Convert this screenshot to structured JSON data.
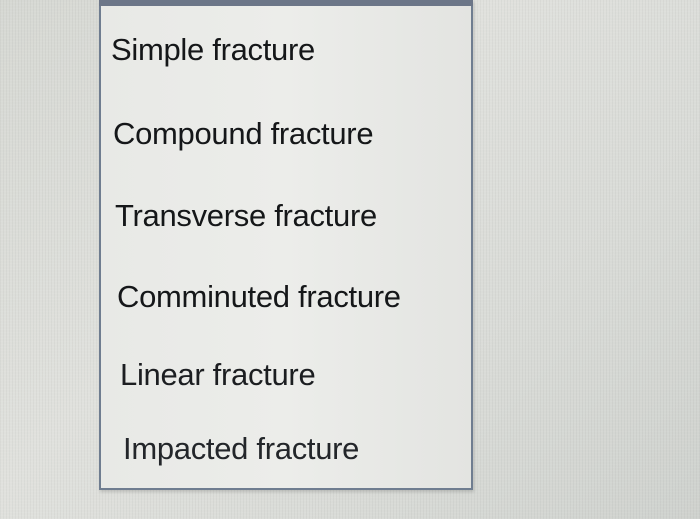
{
  "dropdown": {
    "options": [
      {
        "label": "Simple fracture"
      },
      {
        "label": "Compound fracture"
      },
      {
        "label": "Transverse fracture"
      },
      {
        "label": "Comminuted fracture"
      },
      {
        "label": "Linear fracture"
      },
      {
        "label": "Impacted fracture"
      }
    ]
  },
  "colors": {
    "list_border": "#6f7d90",
    "list_background": "#eaebe8",
    "text": "#151719"
  }
}
